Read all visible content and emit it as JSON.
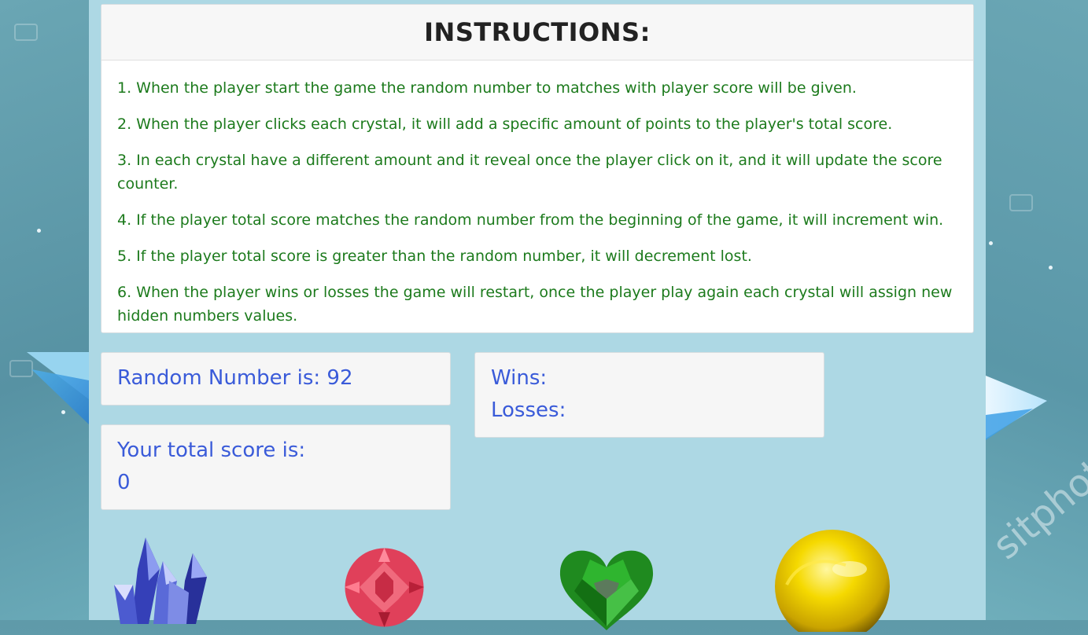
{
  "instructions": {
    "title": "INSTRUCTIONS:",
    "items": [
      "1. When the player start the game the random number to matches with player score will be given.",
      "2. When the player clicks each crystal, it will add a specific amount of points to the player's total score.",
      "3. In each crystal have a different amount and it reveal once the player click on it, and it will update the score counter.",
      "4. If the player total score matches the random number from the beginning of the game, it will increment win.",
      "5. If the player total score is greater than the random number, it will decrement lost.",
      "6. When the player wins or losses the game will restart, once the player play again each crystal will assign new hidden numbers values."
    ]
  },
  "game": {
    "random_label": "Random Number is: 92",
    "wins_label": "Wins:",
    "losses_label": "Losses:",
    "score_label": "Your total score is:",
    "score_value": "0"
  },
  "crystals": [
    {
      "icon": "blue-crystal-cluster-icon"
    },
    {
      "icon": "red-round-gem-icon"
    },
    {
      "icon": "green-heart-gem-icon"
    },
    {
      "icon": "yellow-orb-gem-icon"
    }
  ],
  "background": {
    "watermark": "sitphot"
  },
  "colors": {
    "container_bg": "#add8e4",
    "instruction_text": "#1c7a1c",
    "stat_text": "#3a5bd9"
  }
}
